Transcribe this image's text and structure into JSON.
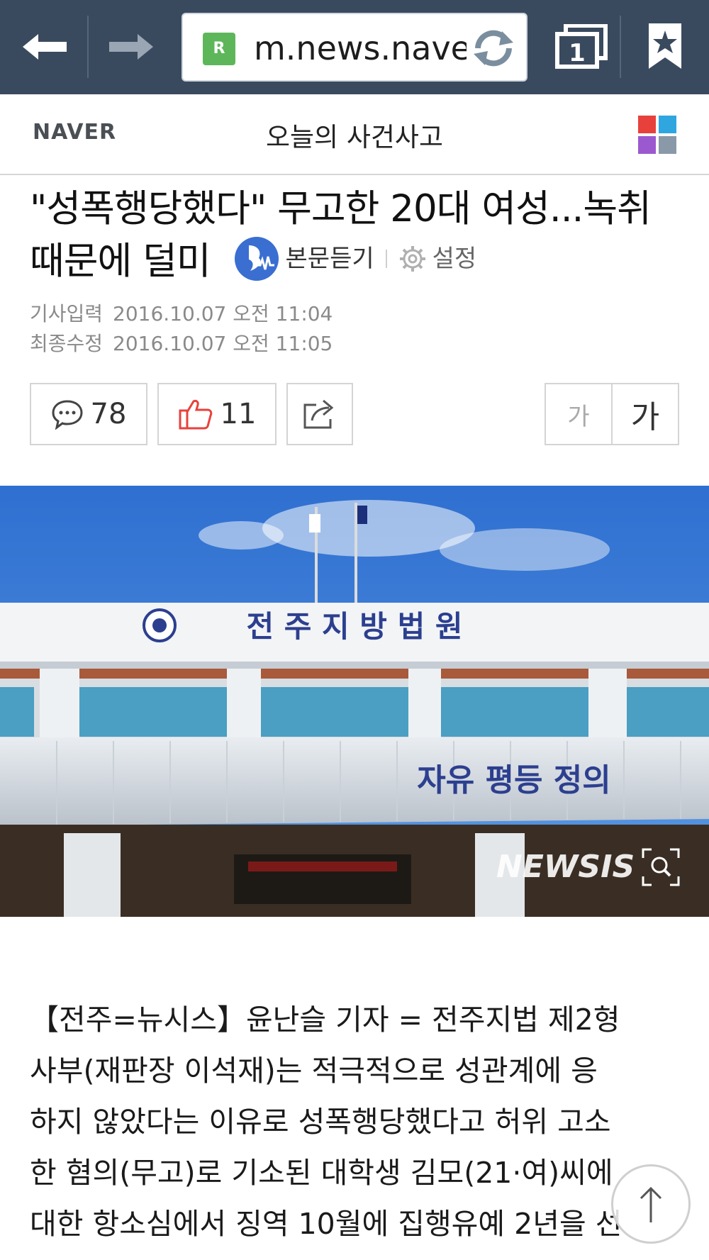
{
  "browser": {
    "url": "m.news.naver.com",
    "tab_count": "1"
  },
  "header": {
    "logo": "NAVER",
    "section": "오늘의 사건사고"
  },
  "article": {
    "title_line1": "\"성폭행당했다\" 무고한 20대 여성...녹취",
    "title_line2": "때문에 덜미",
    "listen_label": "본문듣기",
    "settings_label": "설정",
    "published_label": "기사입력",
    "published_at": "2016.10.07 오전 11:04",
    "modified_label": "최종수정",
    "modified_at": "2016.10.07 오전 11:05"
  },
  "actions": {
    "comments": "78",
    "likes": "11",
    "font_small": "가",
    "font_large": "가"
  },
  "photo": {
    "sign_text": "전 주 지 방 법 원",
    "motto_text": "자유 평등 정의",
    "watermark": "NEWSIS"
  },
  "body": {
    "lines": [
      "【전주=뉴시스】윤난슬 기자 = 전주지법 제2형",
      "사부(재판장 이석재)는 적극적으로 성관계에 응",
      "하지 않았다는 이유로 성폭행당했다고 허위 고소",
      "한 혐의(무고)로 기소된 대학생 김모(21·여)씨에",
      "대한 항소심에서 징역 10월에 집행유예 2년을 선"
    ]
  },
  "colors": {
    "toolbar_bg": "#3a4a5e",
    "listen_blue": "#3a6fd1",
    "like_red": "#e8413c"
  }
}
